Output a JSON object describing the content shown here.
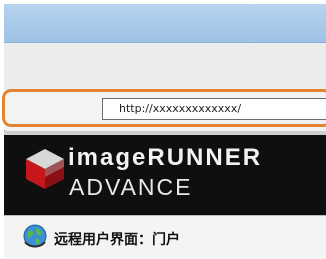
{
  "browser": {
    "address_url": "http://xxxxxxxxxxxxx/"
  },
  "banner": {
    "brand_line1": "imageRUNNER",
    "brand_line2": "ADVANCE",
    "background": "#0f0f0f"
  },
  "portal": {
    "title": "远程用户界面：门户"
  },
  "colors": {
    "highlight": "#e3852e",
    "titlebar": "#a9caeb"
  },
  "icons": {
    "logo": "canon-cube-logo-icon",
    "portal": "globe-icon"
  }
}
